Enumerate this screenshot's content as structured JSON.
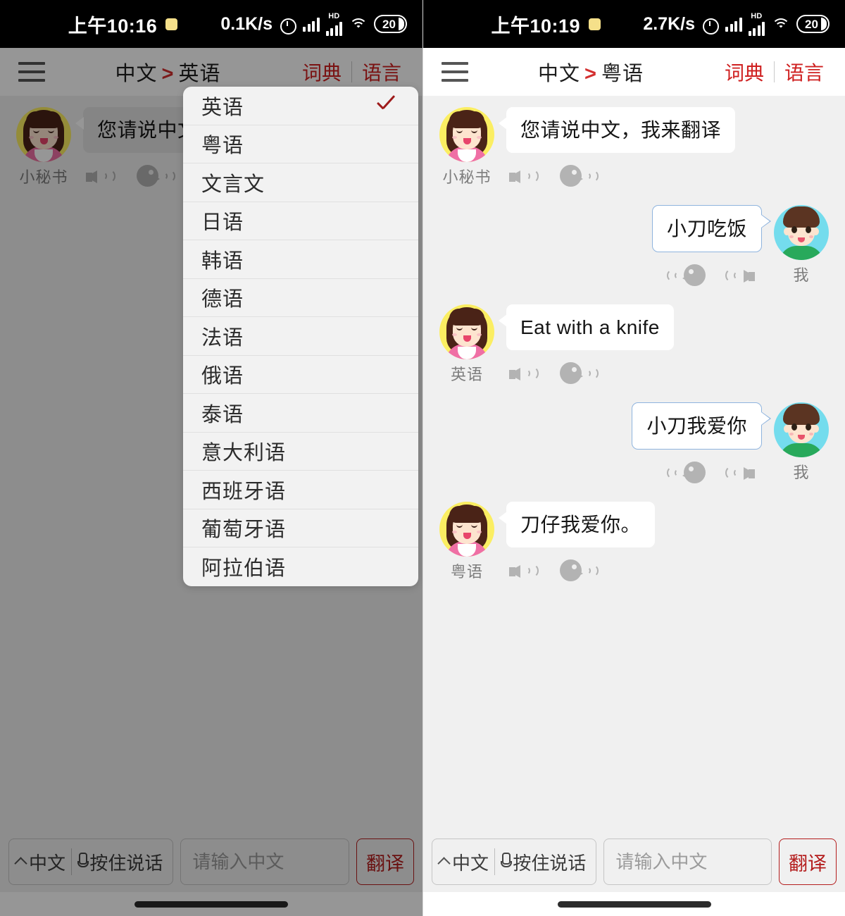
{
  "left": {
    "status": {
      "time": "上午10:16",
      "speed": "0.1K/s",
      "hd": "HD",
      "battery": "20"
    },
    "header": {
      "menu_icon": "hamburger-icon",
      "source_lang": "中文",
      "arrow": ">",
      "target_lang": "英语",
      "dictionary": "词典",
      "language": "语言"
    },
    "messages": [
      {
        "side": "left",
        "speaker": "小秘书",
        "text": "您请说中文，",
        "avatar": "girl"
      }
    ],
    "dropdown": {
      "selected": "英语",
      "check_color": "#9e1b1b",
      "items": [
        "英语",
        "粤语",
        "文言文",
        "日语",
        "韩语",
        "德语",
        "法语",
        "俄语",
        "泰语",
        "意大利语",
        "西班牙语",
        "葡萄牙语",
        "阿拉伯语"
      ]
    },
    "bottom": {
      "mic_lang": "中文",
      "mic_hold": "按住说话",
      "input_value": "",
      "input_placeholder": "请输入中文",
      "translate": "翻译"
    }
  },
  "right": {
    "status": {
      "time": "上午10:19",
      "speed": "2.7K/s",
      "hd": "HD",
      "battery": "20"
    },
    "header": {
      "menu_icon": "hamburger-icon",
      "source_lang": "中文",
      "arrow": ">",
      "target_lang": "粤语",
      "dictionary": "词典",
      "language": "语言"
    },
    "messages": [
      {
        "side": "left",
        "speaker": "小秘书",
        "text": "您请说中文，我来翻译",
        "avatar": "girl"
      },
      {
        "side": "right",
        "speaker": "我",
        "text": "小刀吃饭",
        "avatar": "boy"
      },
      {
        "side": "left",
        "speaker": "英语",
        "text": "Eat with a knife",
        "avatar": "girl"
      },
      {
        "side": "right",
        "speaker": "我",
        "text": "小刀我爱你",
        "avatar": "boy"
      },
      {
        "side": "left",
        "speaker": "粤语",
        "text": "刀仔我爱你。",
        "avatar": "girl"
      }
    ],
    "bottom": {
      "mic_lang": "中文",
      "mic_hold": "按住说话",
      "input_value": "",
      "input_placeholder": "请输入中文",
      "translate": "翻译"
    }
  }
}
